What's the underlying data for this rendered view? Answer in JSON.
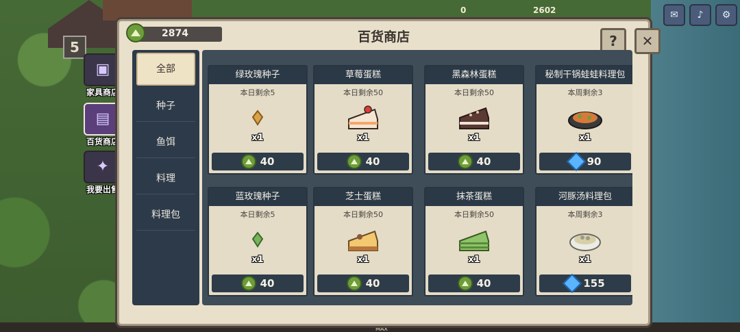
{
  "hud": {
    "level": "5",
    "resource1_value": "0",
    "resource2_value": "2602",
    "max_label": "MAX",
    "icons": [
      "mail-icon",
      "sound-icon",
      "settings-icon"
    ]
  },
  "side_menu": [
    {
      "label": "家具商店",
      "icon": "furniture-icon"
    },
    {
      "label": "百货商店",
      "icon": "store-icon",
      "active": true
    },
    {
      "label": "我要出售",
      "icon": "sell-icon"
    }
  ],
  "shop": {
    "title": "百货商店",
    "coins": "2874",
    "tabs": [
      "全部",
      "种子",
      "鱼饵",
      "料理",
      "料理包"
    ],
    "active_tab": "全部",
    "items": [
      {
        "name": "绿玫瑰种子",
        "remain": "本日剩余5",
        "qty": "x1",
        "price": "40",
        "currency": "coin",
        "icon": "green-rose-seed-icon"
      },
      {
        "name": "草莓蛋糕",
        "remain": "本日剩余50",
        "qty": "x1",
        "price": "40",
        "currency": "coin",
        "icon": "strawberry-cake-icon"
      },
      {
        "name": "黑森林蛋糕",
        "remain": "本日剩余50",
        "qty": "x1",
        "price": "40",
        "currency": "coin",
        "icon": "black-forest-cake-icon"
      },
      {
        "name": "秘制干锅蛙蛙料理包",
        "remain": "本周剩余3",
        "qty": "x1",
        "price": "90",
        "currency": "gem",
        "icon": "frog-dish-pack-icon"
      },
      {
        "name": "蓝玫瑰种子",
        "remain": "本日剩余5",
        "qty": "x1",
        "price": "40",
        "currency": "coin",
        "icon": "blue-rose-seed-icon"
      },
      {
        "name": "芝士蛋糕",
        "remain": "本日剩余50",
        "qty": "x1",
        "price": "40",
        "currency": "coin",
        "icon": "cheesecake-icon"
      },
      {
        "name": "抹茶蛋糕",
        "remain": "本日剩余50",
        "qty": "x1",
        "price": "40",
        "currency": "coin",
        "icon": "matcha-cake-icon"
      },
      {
        "name": "河豚汤料理包",
        "remain": "本周剩余3",
        "qty": "x1",
        "price": "155",
        "currency": "gem",
        "icon": "pufferfish-soup-pack-icon"
      }
    ]
  }
}
